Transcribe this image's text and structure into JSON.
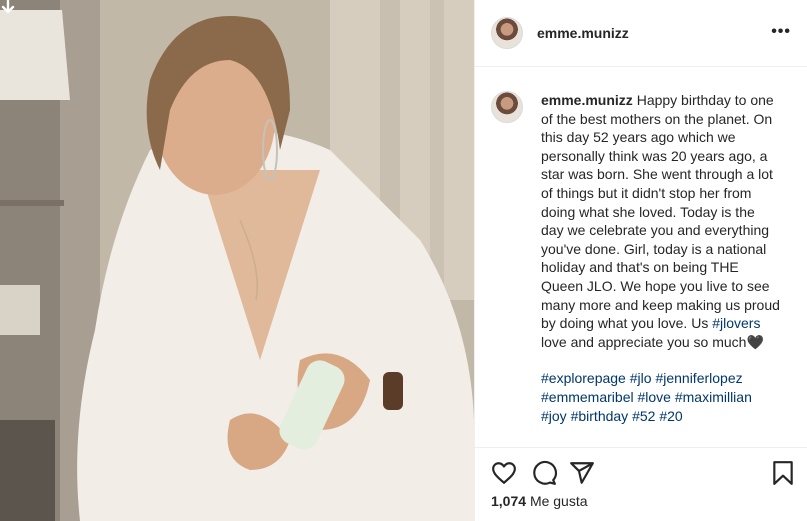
{
  "post": {
    "username": "emme.munizz",
    "more_label": "•••",
    "caption": {
      "username": "emme.munizz",
      "text_before_tag": "Happy birthday to one of the best mothers on the planet. On this day 52 years ago which we personally think was 20 years ago, a star was born. She went through a lot of things but it didn't stop her from doing what she loved. Today is the day we celebrate you and everything you've done. Girl, today is a national holiday and that's on being THE Queen JLO. We hope you live to see many more and keep making us proud by doing what you love. Us",
      "inline_tag": "#jlovers",
      "text_after_tag": "love and appreciate you so much",
      "emoji": "🖤"
    },
    "hashtags": [
      "#explorepage",
      "#jlo",
      "#jenniferlopez",
      "#emmemaribel",
      "#love",
      "#maximillian",
      "#joy",
      "#birthday",
      "#52",
      "#20"
    ],
    "likes_count": "1,074",
    "likes_word": "Me gusta",
    "icons": {
      "download": "download-arrow-icon",
      "like": "heart-icon",
      "comment": "comment-bubble-icon",
      "share": "share-plane-icon",
      "save": "bookmark-icon"
    },
    "colors": {
      "text": "#262626",
      "hashtag": "#00376b",
      "border": "#efefef"
    }
  }
}
